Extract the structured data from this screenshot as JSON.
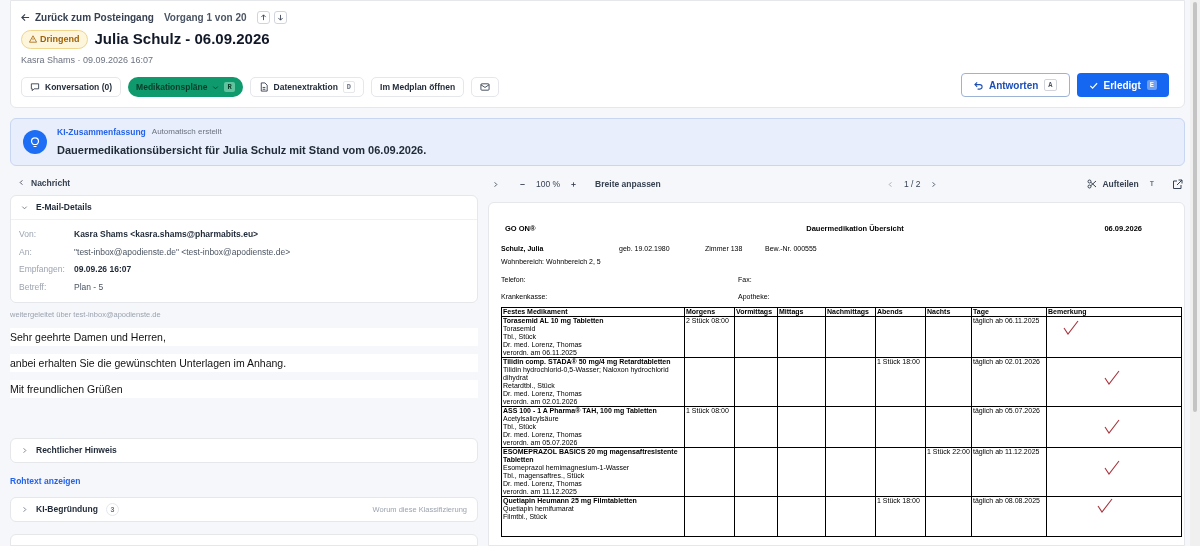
{
  "header": {
    "back_link": "Zurück zum Posteingang",
    "position": "Vorgang 1 von 20",
    "badge": "Dringend",
    "title": "Julia Schulz - 06.09.2026",
    "meta": "Kasra Shams · 09.09.2026 16:07",
    "tabs": [
      {
        "kind": "chat",
        "label": "Konversation (0)",
        "selected": false
      },
      {
        "kind": "dropdown",
        "label": "Medikationspläne",
        "shortcut": "R",
        "selected": true
      },
      {
        "kind": "doc",
        "label": "Datenextraktion",
        "shortcut": "D",
        "selected": false
      },
      {
        "kind": "plain",
        "label": "Im Medplan öffnen",
        "selected": false
      },
      {
        "kind": "mail",
        "selected": false
      }
    ],
    "actions": [
      {
        "kind": "reply",
        "label": "Antworten",
        "shortcut": "A"
      },
      {
        "kind": "done",
        "label": "Erledigt",
        "shortcut": "E"
      }
    ]
  },
  "summary": {
    "title": "KI-Zusammenfassung",
    "note": "Automatisch erstellt",
    "text": "Dauermedikationsübersicht für Julia Schulz mit Stand vom 06.09.2026."
  },
  "message": {
    "back": "Nachricht",
    "details": {
      "title": "E-Mail-Details",
      "expanded": true,
      "fields": [
        {
          "label": "Von:",
          "value": "Kasra Shams <kasra.shams@pharmabits.eu>",
          "bold": true
        },
        {
          "label": "An:",
          "value": "\"test-inbox@apodienste.de\" <test-inbox@apodienste.de>",
          "bold": false
        },
        {
          "label": "Empfangen:",
          "value": "09.09.26 16:07",
          "bold": true
        },
        {
          "label": "Betreff:",
          "value": "Plan - 5",
          "bold": false
        }
      ]
    },
    "forwarded": "weitergeleitet über test-inbox@apodienste.de",
    "body": [
      "Sehr geehrte Damen und Herren,",
      "anbei erhalten Sie die gewünschten Unterlagen im Anhang.",
      "Mit freundlichen Grüßen"
    ],
    "legal": {
      "title": "Rechtlicher Hinweis",
      "expanded": false
    },
    "raw_link": "Rohtext anzeigen",
    "reasoning": {
      "title": "KI-Begründung",
      "count": "3",
      "hint": "Worum diese Klassifizierung",
      "expanded": false
    }
  },
  "viewer": {
    "zoom": "100 %",
    "fit": "Breite anpassen",
    "page": "1 / 2",
    "split": "Aufteilen",
    "split_key": "T",
    "document": {
      "brand": "GO ON®",
      "title": "Dauermedikation Übersicht",
      "date": "06.09.2026",
      "patient": "Schulz, Julia",
      "born": "geb. 19.02.1980",
      "room": "Zimmer 138",
      "resident_no": "Bew.-Nr. 000555",
      "area": "Wohnbereich: Wohnbereich 2, 5",
      "phone": "Telefon:",
      "fax": "Fax:",
      "insurance": "Krankenkasse:",
      "pharmacy": "Apotheke:",
      "columns": [
        "Festes Medikament",
        "Morgens",
        "Vormittags",
        "Mittags",
        "Nachmittags",
        "Abends",
        "Nachts",
        "Tage",
        "Bemerkung"
      ],
      "rows": [
        {
          "name": "Torasemid AL 10 mg Tabletten",
          "lines": [
            "Torasemid",
            "Tbl., Stück",
            "Dr. med. Lorenz, Thomas",
            "verordn. am 06.11.2025"
          ],
          "doses": {
            "morning": "2 Stück  08:00"
          },
          "days": "täglich ab 06.11.2025",
          "checked": true
        },
        {
          "name": "Tilidin comp. STADA® 50 mg/4 mg Retardtabletten",
          "lines": [
            "Tilidin hydrochlorid-0,5-Wasser; Naloxon hydrochlorid dihydrat",
            "Retardtbl., Stück",
            "Dr. med. Lorenz, Thomas",
            "verordn. am 02.01.2026"
          ],
          "doses": {
            "evening": "1 Stück  18:00"
          },
          "days": "täglich ab 02.01.2026",
          "checked": true
        },
        {
          "name": "ASS 100 - 1 A Pharma® TAH, 100 mg Tabletten",
          "lines": [
            "Acetylsalicylsäure",
            "Tbl., Stück",
            "Dr. med. Lorenz, Thomas",
            "verordn. am 05.07.2026"
          ],
          "doses": {
            "morning": "1 Stück  08:00"
          },
          "days": "täglich ab 05.07.2026",
          "checked": true
        },
        {
          "name": "ESOMEPRAZOL BASICS 20 mg magensaftresistente Tabletten",
          "lines": [
            "Esomeprazol hemimagnesium-1-Wasser",
            "Tbl., magensaftres., Stück",
            "Dr. med. Lorenz, Thomas",
            "verordn. am 11.12.2025"
          ],
          "doses": {
            "night": "1 Stück  22:00"
          },
          "days": "täglich ab 11.12.2025",
          "checked": true
        },
        {
          "name": "Quetiapin Heumann 25 mg Filmtabletten",
          "lines": [
            "Quetiapin hemifumarat",
            "Filmtbl., Stück"
          ],
          "doses": {
            "evening": "1 Stück  18:00"
          },
          "days": "täglich ab 08.08.2025",
          "checked": true
        }
      ]
    }
  }
}
